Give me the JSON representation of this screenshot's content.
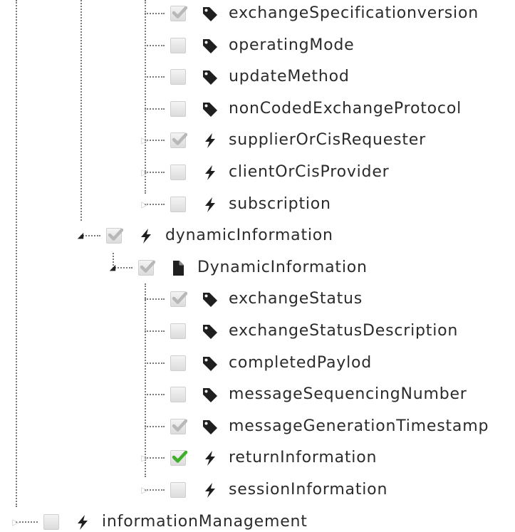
{
  "tree": {
    "nodes": [
      {
        "label": "exchangeSpecificationversion",
        "icon": "tag-icon",
        "checkbox": "checked",
        "toggle": "none"
      },
      {
        "label": "operatingMode",
        "icon": "tag-icon",
        "checkbox": "unchecked",
        "toggle": "none"
      },
      {
        "label": "updateMethod",
        "icon": "tag-icon",
        "checkbox": "unchecked",
        "toggle": "none"
      },
      {
        "label": "nonCodedExchangeProtocol",
        "icon": "tag-icon",
        "checkbox": "unchecked",
        "toggle": "none"
      },
      {
        "label": "supplierOrCisRequester",
        "icon": "bolt-icon",
        "checkbox": "checked",
        "toggle": "collapsed"
      },
      {
        "label": "clientOrCisProvider",
        "icon": "bolt-icon",
        "checkbox": "unchecked",
        "toggle": "collapsed"
      },
      {
        "label": "subscription",
        "icon": "bolt-icon",
        "checkbox": "unchecked",
        "toggle": "collapsed"
      },
      {
        "label": "dynamicInformation",
        "icon": "bolt-icon",
        "checkbox": "checked",
        "toggle": "expanded"
      },
      {
        "label": "DynamicInformation",
        "icon": "document-icon",
        "checkbox": "checked",
        "toggle": "expanded"
      },
      {
        "label": "exchangeStatus",
        "icon": "tag-icon",
        "checkbox": "checked",
        "toggle": "none"
      },
      {
        "label": "exchangeStatusDescription",
        "icon": "tag-icon",
        "checkbox": "unchecked",
        "toggle": "none"
      },
      {
        "label": "completedPaylod",
        "icon": "tag-icon",
        "checkbox": "unchecked",
        "toggle": "none"
      },
      {
        "label": "messageSequencingNumber",
        "icon": "tag-icon",
        "checkbox": "unchecked",
        "toggle": "none"
      },
      {
        "label": "messageGenerationTimestamp",
        "icon": "tag-icon",
        "checkbox": "checked",
        "toggle": "none"
      },
      {
        "label": "returnInformation",
        "icon": "bolt-icon",
        "checkbox": "checked-green",
        "toggle": "collapsed"
      },
      {
        "label": "sessionInformation",
        "icon": "bolt-icon",
        "checkbox": "unchecked",
        "toggle": "collapsed"
      },
      {
        "label": "informationManagement",
        "icon": "bolt-icon",
        "checkbox": "unchecked",
        "toggle": "collapsed"
      }
    ]
  },
  "colors": {
    "label": "#2b2b2b",
    "icon": "#1f1f1f",
    "check_grey": "#b8b8b8",
    "check_green": "#3fae2a",
    "connector": "#7a7a7a"
  }
}
